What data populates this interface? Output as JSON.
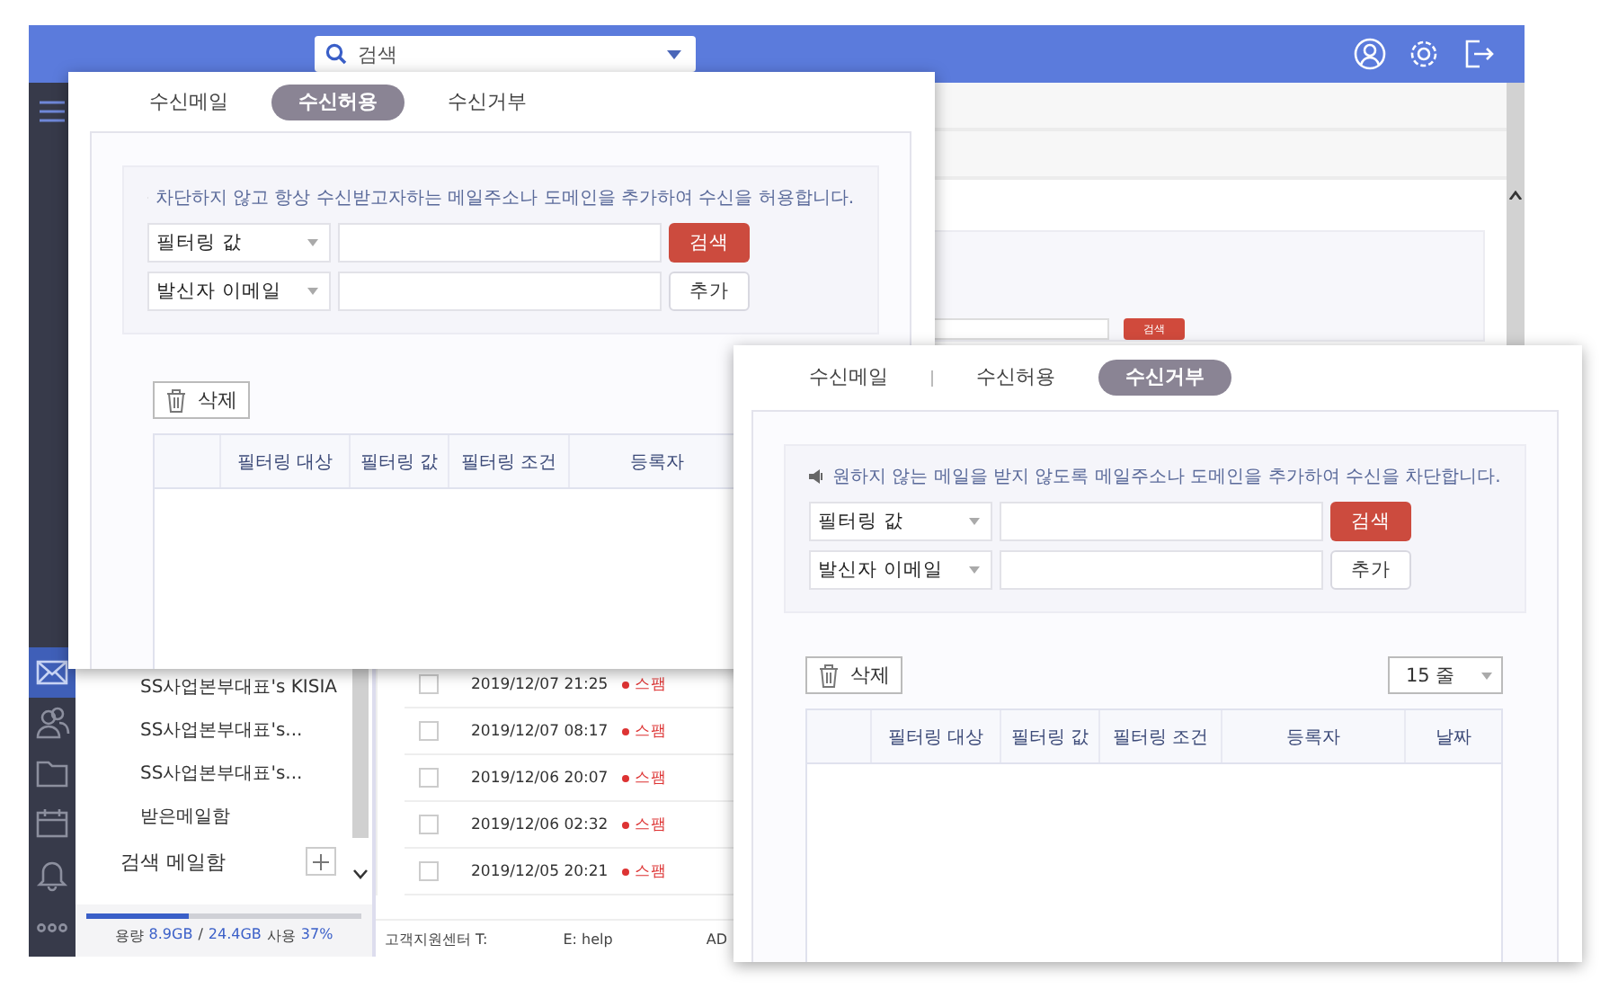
{
  "app": {
    "search": {
      "placeholder": "검색"
    },
    "rail": [
      {
        "kind": "mail",
        "selected": true
      },
      {
        "kind": "people",
        "selected": false
      },
      {
        "kind": "folder",
        "selected": false
      },
      {
        "kind": "calendar",
        "selected": false
      },
      {
        "kind": "bell",
        "selected": false
      },
      {
        "kind": "more",
        "selected": false
      }
    ],
    "sidebar": {
      "items": [
        {
          "kind": "folder",
          "label": "SS사업본부대표's KISIA"
        },
        {
          "kind": "folder",
          "label": "SS사업본부대표's..."
        },
        {
          "kind": "folder",
          "label": "SS사업본부대표's..."
        },
        {
          "kind": "folder",
          "label": "받은메일함"
        },
        {
          "kind": "section",
          "label": "검색 메일함"
        }
      ],
      "storage": {
        "label": "용량",
        "used": "8.9GB",
        "separator": "/",
        "total": "24.4GB",
        "used_label": "사용",
        "percent": "37%",
        "level": 0.37
      }
    },
    "filter_button": "검색",
    "mails": [
      {
        "checked": false,
        "date": "2019/12/07 21:25",
        "tag": "스팸"
      },
      {
        "checked": false,
        "date": "2019/12/07 08:17",
        "tag": "스팸"
      },
      {
        "checked": false,
        "date": "2019/12/06 20:07",
        "tag": "스팸"
      },
      {
        "checked": false,
        "date": "2019/12/06 02:32",
        "tag": "스팸"
      },
      {
        "checked": false,
        "date": "2019/12/05 20:21",
        "tag": "스팸"
      }
    ],
    "footer": [
      "고객지원센터 T:",
      "E: help",
      "AD"
    ]
  },
  "dialogs": [
    {
      "tabs": [
        {
          "label": "수신메일",
          "selected": false
        },
        {
          "label": "수신허용",
          "selected": true
        },
        {
          "label": "수신거부",
          "selected": false
        }
      ],
      "notice": "차단하지 않고 항상 수신받고자하는 메일주소나 도메인을 추가하여 수신을 허용합니다.",
      "filters": [
        {
          "select": "필터링 값",
          "button": "검색",
          "kind": "search"
        },
        {
          "select": "발신자 이메일",
          "button": "추가",
          "kind": "add"
        }
      ],
      "delete": "삭제",
      "columns": [
        "필터링 대상",
        "필터링 값",
        "필터링 조건",
        "등록자"
      ]
    },
    {
      "tabs": [
        {
          "label": "수신메일",
          "selected": false
        },
        {
          "label": "수신허용",
          "selected": false
        },
        {
          "label": "수신거부",
          "selected": true
        }
      ],
      "notice": "원하지 않는 메일을 받지 않도록 메일주소나 도메인을 추가하여 수신을 차단합니다.",
      "filters": [
        {
          "select": "필터링 값",
          "button": "검색",
          "kind": "search"
        },
        {
          "select": "발신자 이메일",
          "button": "추가",
          "kind": "add"
        }
      ],
      "delete": "삭제",
      "page_size": "15 줄",
      "columns": [
        "필터링 대상",
        "필터링 값",
        "필터링 조건",
        "등록자",
        "날짜"
      ]
    }
  ]
}
